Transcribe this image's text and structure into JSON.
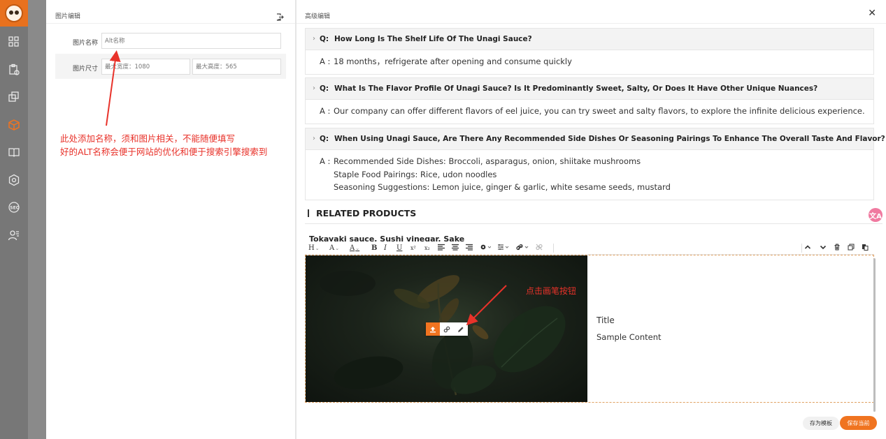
{
  "image_edit": {
    "title": "图片编辑",
    "name_label": "图片名称",
    "name_placeholder": "Alt名称",
    "size_label": "图片尺寸",
    "max_width_placeholder": "最大宽度：1080",
    "max_height_placeholder": "最大高度：565"
  },
  "annotations": {
    "left_line1": "此处添加名称，须和图片相关，不能随便填写",
    "left_line2": "好的ALT名称会便于网站的优化和便于搜索引擎搜索到",
    "right": "点击画笔按钮"
  },
  "advanced_edit": {
    "title": "高级编辑",
    "close_glyph": "✕"
  },
  "faq": [
    {
      "q_key": "Q:",
      "question": "How Long Is The Shelf Life Of The Unagi Sauce?",
      "a_key": "A :",
      "answer_lines": [
        "18 months，refrigerate after opening and consume quickly"
      ]
    },
    {
      "q_key": "Q:",
      "question": "What Is The Flavor Profile Of Unagi Sauce? Is It Predominantly Sweet, Salty, Or Does It Have Other Unique Nuances?",
      "a_key": "A :",
      "answer_lines": [
        "Our company can offer different flavors of eel juice, you can try sweet and salty flavors, to explore the infinite delicious experience."
      ]
    },
    {
      "q_key": "Q:",
      "question": "When Using Unagi Sauce, Are There Any Recommended Side Dishes Or Seasoning Pairings To Enhance The Overall Taste And Flavor?",
      "a_key": "A :",
      "answer_lines": [
        "Recommended Side Dishes: Broccoli, asparagus, onion, shiitake mushrooms",
        "Staple Food Pairings: Rice, udon noodles",
        "Seasoning Suggestions: Lemon juice, ginger & garlic, white sesame seeds, mustard"
      ]
    }
  ],
  "related": {
    "heading": "RELATED PRODUCTS",
    "items_text": "Tokayaki sauce,  Sushi vinegar,  Sake"
  },
  "toolbar": {
    "heading": "H",
    "font": "A",
    "color": "A",
    "bold": "B",
    "italic": "I",
    "underline": "U",
    "superscript": "x²",
    "subscript": "x₂",
    "caret": "⌄"
  },
  "editor": {
    "title": "Title",
    "content": "Sample Content"
  },
  "translate_badge": "文A",
  "buttons": {
    "save_template": "存为模板",
    "save_current": "保存当前"
  },
  "colors": {
    "accent": "#f07420",
    "annotation": "#e8322a"
  }
}
